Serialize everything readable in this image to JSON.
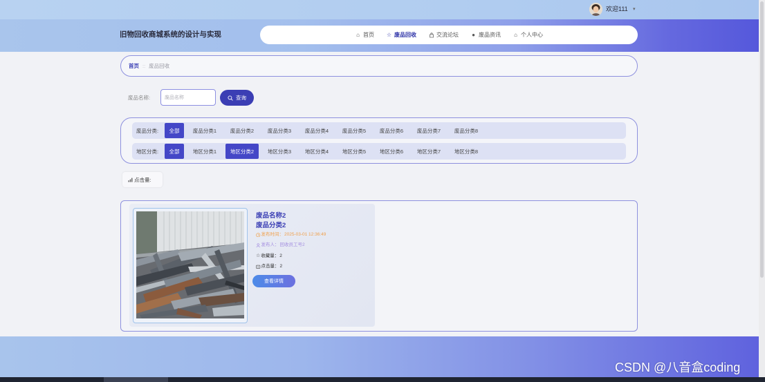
{
  "colors": {
    "primary": "#4447c7",
    "primary_dark": "#3b3eb4",
    "border": "#8d90de",
    "title_text": "#3c40b5",
    "time_text": "#f0a04b",
    "publisher_text": "#a48ee0",
    "button_blue": "#4d8be8",
    "button_purple": "#6c70df"
  },
  "topbar": {
    "welcome": "欢迎111",
    "caret": "▾"
  },
  "header": {
    "title": "旧物回收商城系统的设计与实现",
    "nav": [
      {
        "icon": "home-icon",
        "label": "首页",
        "active": false
      },
      {
        "icon": "star-icon",
        "label": "废品回收",
        "active": true
      },
      {
        "icon": "forum-icon",
        "label": "交流论坛",
        "active": false
      },
      {
        "icon": "news-icon",
        "label": "废品资讯",
        "active": false
      },
      {
        "icon": "user-center-icon",
        "label": "个人中心",
        "active": false
      }
    ]
  },
  "breadcrumb": {
    "home": "首页",
    "separator": "::",
    "current": "废品回收"
  },
  "search": {
    "label": "废品名称:",
    "placeholder": "废品名称",
    "value": "",
    "button_icon": "search-icon",
    "button_label": "查询"
  },
  "filters": {
    "category": {
      "label": "废品分类:",
      "options": [
        {
          "label": "全部",
          "active": true
        },
        {
          "label": "废品分类1",
          "active": false
        },
        {
          "label": "废品分类2",
          "active": false
        },
        {
          "label": "废品分类3",
          "active": false
        },
        {
          "label": "废品分类4",
          "active": false
        },
        {
          "label": "废品分类5",
          "active": false
        },
        {
          "label": "废品分类6",
          "active": false
        },
        {
          "label": "废品分类7",
          "active": false
        },
        {
          "label": "废品分类8",
          "active": false
        }
      ]
    },
    "region": {
      "label": "地区分类:",
      "options": [
        {
          "label": "全部",
          "active": true
        },
        {
          "label": "地区分类1",
          "active": false
        },
        {
          "label": "地区分类2",
          "active": true
        },
        {
          "label": "地区分类3",
          "active": false
        },
        {
          "label": "地区分类4",
          "active": false
        },
        {
          "label": "地区分类5",
          "active": false
        },
        {
          "label": "地区分类6",
          "active": false
        },
        {
          "label": "地区分类7",
          "active": false
        },
        {
          "label": "地区分类8",
          "active": false
        }
      ]
    }
  },
  "sort": {
    "icon": "sort-icon",
    "label": "点击量:"
  },
  "products": [
    {
      "name": "废品名称2",
      "category": "废品分类2",
      "publish_time_label": "发布时间：",
      "publish_time": "2025-03-01 12:36:49",
      "publisher_label": "发布人：",
      "publisher": "回收员工号2",
      "favorites_label": "收藏量：",
      "favorites": "2",
      "clicks_label": "点击量：",
      "clicks": "2",
      "detail_button": "查看详情"
    }
  ],
  "watermark": "CSDN @八音盒coding"
}
